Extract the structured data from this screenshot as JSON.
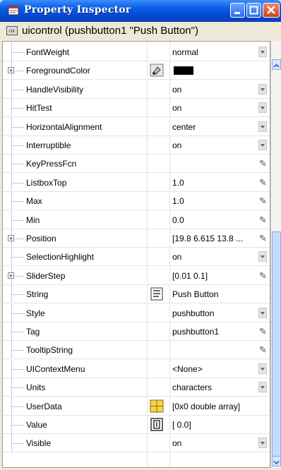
{
  "window": {
    "title": "Property Inspector"
  },
  "header": {
    "object_label": "uicontrol (pushbutton1 \"Push Button\")",
    "icon_text": "OK"
  },
  "rows": [
    {
      "name": "FontWeight",
      "value": "normal",
      "control": "dropdown",
      "expandable": false
    },
    {
      "name": "ForegroundColor",
      "value": "",
      "control": "none",
      "expandable": true,
      "editor_icon": "color-picker-icon",
      "swatch": "#000000"
    },
    {
      "name": "HandleVisibility",
      "value": "on",
      "control": "dropdown",
      "expandable": false
    },
    {
      "name": "HitTest",
      "value": "on",
      "control": "dropdown",
      "expandable": false
    },
    {
      "name": "HorizontalAlignment",
      "value": "center",
      "control": "dropdown",
      "expandable": false
    },
    {
      "name": "Interruptible",
      "value": "on",
      "control": "dropdown",
      "expandable": false
    },
    {
      "name": "KeyPressFcn",
      "value": "",
      "control": "pencil",
      "expandable": false
    },
    {
      "name": "ListboxTop",
      "value": "1.0",
      "control": "pencil",
      "expandable": false
    },
    {
      "name": "Max",
      "value": "1.0",
      "control": "pencil",
      "expandable": false
    },
    {
      "name": "Min",
      "value": "0.0",
      "control": "pencil",
      "expandable": false
    },
    {
      "name": "Position",
      "value": "[19.8 6.615 13.8 ...",
      "control": "pencil",
      "expandable": true
    },
    {
      "name": "SelectionHighlight",
      "value": "on",
      "control": "dropdown",
      "expandable": false
    },
    {
      "name": "SliderStep",
      "value": "[0.01 0.1]",
      "control": "pencil",
      "expandable": true
    },
    {
      "name": "String",
      "value": "Push Button",
      "control": "none",
      "expandable": false,
      "editor_icon": "text-editor-icon"
    },
    {
      "name": "Style",
      "value": "pushbutton",
      "control": "dropdown",
      "expandable": false
    },
    {
      "name": "Tag",
      "value": "pushbutton1",
      "control": "pencil",
      "expandable": false
    },
    {
      "name": "TooltipString",
      "value": "",
      "control": "pencil",
      "expandable": false
    },
    {
      "name": "UIContextMenu",
      "value": "<None>",
      "control": "dropdown",
      "expandable": false
    },
    {
      "name": "Units",
      "value": "characters",
      "control": "dropdown",
      "expandable": false
    },
    {
      "name": "UserData",
      "value": "[0x0  double array]",
      "control": "none",
      "expandable": false,
      "editor_icon": "array-editor-icon"
    },
    {
      "name": "Value",
      "value": "[ 0.0]",
      "control": "none",
      "expandable": false,
      "editor_icon": "value-editor-icon"
    },
    {
      "name": "Visible",
      "value": "on",
      "control": "dropdown",
      "expandable": false
    }
  ],
  "colors": {
    "titlebar": "#0a5fe8",
    "swatch": "#000000"
  }
}
